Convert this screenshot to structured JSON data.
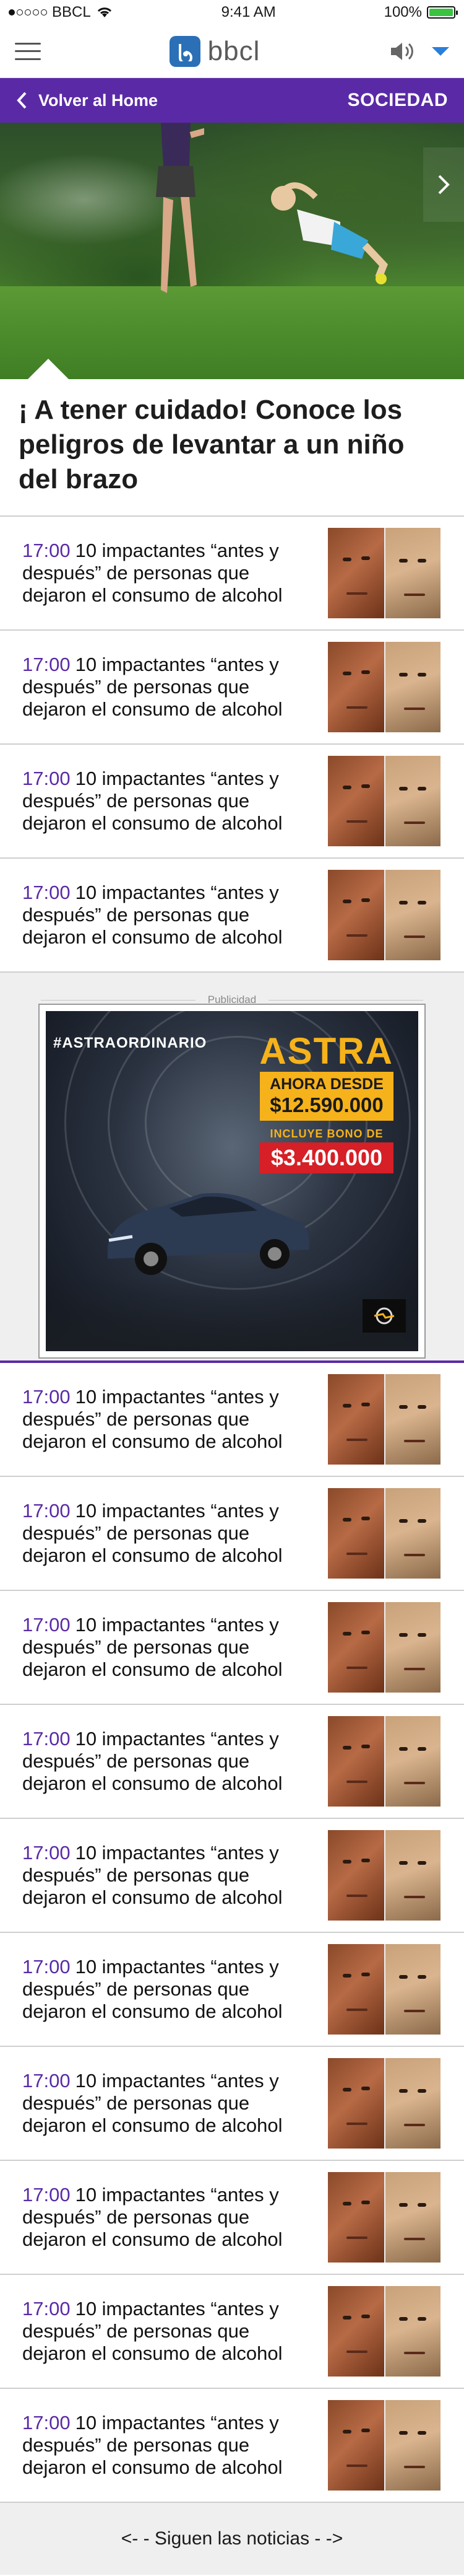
{
  "status_bar": {
    "carrier": "BBCL",
    "time": "9:41 AM",
    "battery": "100%",
    "battery_level": 1.0
  },
  "header": {
    "logo_text": "bbcl",
    "menu_icon": "hamburger-icon",
    "sound_icon": "speaker-icon",
    "dropdown_icon": "caret-down-icon",
    "accent_color": "#2b7fd9"
  },
  "section_bar": {
    "back_label": "Volver al Home",
    "section_name": "SOCIEDAD",
    "color": "#5a2aa6"
  },
  "hero": {
    "title": "¡ A tener cuidado! Conoce los peligros de levantar a un niño del brazo",
    "next_icon": "chevron-right-icon"
  },
  "news_top": [
    {
      "time": "17:00",
      "headline": "10 impactantes “antes y después” de personas que dejaron el consumo de alcohol"
    },
    {
      "time": "17:00",
      "headline": "10 impactantes “antes y después” de personas que dejaron el consumo de alcohol"
    },
    {
      "time": "17:00",
      "headline": "10 impactantes “antes y después” de personas que dejaron el consumo de alcohol"
    },
    {
      "time": "17:00",
      "headline": "10 impactantes “antes y después” de personas que dejaron el consumo de alcohol"
    }
  ],
  "ad": {
    "label": "Publicidad",
    "hashtag": "#ASTRAORDINARIO",
    "brand": "ASTRA",
    "price_line1": "AHORA DESDE",
    "price_line2": "$12.590.000",
    "bonus_label": "INCLUYE BONO DE",
    "bonus_value": "$3.400.000"
  },
  "news_bottom": [
    {
      "time": "17:00",
      "headline": "10 impactantes “antes y después” de personas que dejaron el consumo de alcohol"
    },
    {
      "time": "17:00",
      "headline": "10 impactantes “antes y después” de personas que dejaron el consumo de alcohol"
    },
    {
      "time": "17:00",
      "headline": "10 impactantes “antes y después” de personas que dejaron el consumo de alcohol"
    },
    {
      "time": "17:00",
      "headline": "10 impactantes “antes y después” de personas que dejaron el consumo de alcohol"
    },
    {
      "time": "17:00",
      "headline": "10 impactantes “antes y después” de personas que dejaron el consumo de alcohol"
    },
    {
      "time": "17:00",
      "headline": "10 impactantes “antes y después” de personas que dejaron el consumo de alcohol"
    },
    {
      "time": "17:00",
      "headline": "10 impactantes “antes y después” de personas que dejaron el consumo de alcohol"
    },
    {
      "time": "17:00",
      "headline": "10 impactantes “antes y después” de personas que dejaron el consumo de alcohol"
    },
    {
      "time": "17:00",
      "headline": "10 impactantes “antes y después” de personas que dejaron el consumo de alcohol"
    },
    {
      "time": "17:00",
      "headline": "10 impactantes “antes y después” de personas que dejaron el consumo de alcohol"
    }
  ],
  "footer": {
    "label": "<- - Siguen las noticias - ->"
  }
}
